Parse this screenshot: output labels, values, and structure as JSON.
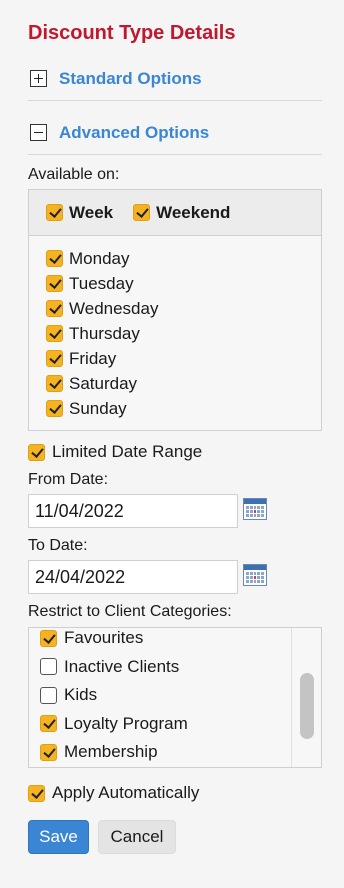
{
  "title": "Discount Type Details",
  "sections": {
    "standard": {
      "label": "Standard Options",
      "expanded": false
    },
    "advanced": {
      "label": "Advanced Options",
      "expanded": true
    }
  },
  "available_on": {
    "label": "Available on:",
    "week": {
      "label": "Week",
      "checked": true
    },
    "weekend": {
      "label": "Weekend",
      "checked": true
    },
    "days": [
      {
        "label": "Monday",
        "checked": true
      },
      {
        "label": "Tuesday",
        "checked": true
      },
      {
        "label": "Wednesday",
        "checked": true
      },
      {
        "label": "Thursday",
        "checked": true
      },
      {
        "label": "Friday",
        "checked": true
      },
      {
        "label": "Saturday",
        "checked": true
      },
      {
        "label": "Sunday",
        "checked": true
      }
    ]
  },
  "limited_date_range": {
    "label": "Limited Date Range",
    "checked": true
  },
  "from_date": {
    "label": "From Date:",
    "value": "11/04/2022"
  },
  "to_date": {
    "label": "To Date:",
    "value": "24/04/2022"
  },
  "client_categories": {
    "label": "Restrict to Client Categories:",
    "items": [
      {
        "label": "Favourites",
        "checked": true
      },
      {
        "label": "Inactive Clients",
        "checked": false
      },
      {
        "label": "Kids",
        "checked": false
      },
      {
        "label": "Loyalty Program",
        "checked": true
      },
      {
        "label": "Membership",
        "checked": true
      }
    ]
  },
  "apply_automatically": {
    "label": "Apply Automatically",
    "checked": true
  },
  "buttons": {
    "save": "Save",
    "cancel": "Cancel"
  },
  "colors": {
    "title": "#c0182f",
    "link": "#3a86d4",
    "checkbox": "#f5b323",
    "save_button": "#3a86d4"
  }
}
